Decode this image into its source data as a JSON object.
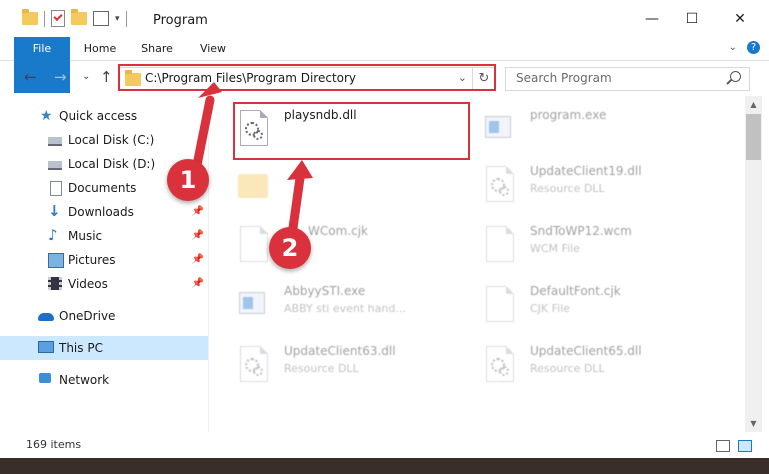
{
  "window": {
    "title": "Program",
    "controls": {
      "minimize": "—",
      "maximize": "☐",
      "close": "✕"
    }
  },
  "ribbon": {
    "tabs": [
      "File",
      "Home",
      "Share",
      "View"
    ],
    "help": "?"
  },
  "navbar": {
    "back": "←",
    "forward": "→",
    "recent": "⌄",
    "up": "↑",
    "address": "C:\\Program Files\\Program Directory",
    "refresh": "↻",
    "search_placeholder": "Search Program"
  },
  "sidebar": {
    "items": [
      {
        "label": "Quick access",
        "icon": "star-icon",
        "pinned": false
      },
      {
        "label": "Local Disk (C:)",
        "icon": "disk-icon",
        "pinned": false
      },
      {
        "label": "Local Disk (D:)",
        "icon": "disk-icon",
        "pinned": false
      },
      {
        "label": "Documents",
        "icon": "documents-icon",
        "pinned": false
      },
      {
        "label": "Downloads",
        "icon": "downloads-icon",
        "pinned": true
      },
      {
        "label": "Music",
        "icon": "music-icon",
        "pinned": true
      },
      {
        "label": "Pictures",
        "icon": "pictures-icon",
        "pinned": true
      },
      {
        "label": "Videos",
        "icon": "videos-icon",
        "pinned": true
      },
      {
        "label": "OneDrive",
        "icon": "onedrive-icon",
        "pinned": false
      },
      {
        "label": "This PC",
        "icon": "this-pc-icon",
        "pinned": false,
        "selected": true
      },
      {
        "label": "Network",
        "icon": "network-icon",
        "pinned": false
      }
    ]
  },
  "files": [
    {
      "name": "playsndb.dll",
      "desc": "",
      "type": "dll",
      "highlighted": true
    },
    {
      "name": "program.exe",
      "desc": "",
      "type": "exe"
    },
    {
      "name": "",
      "desc": "",
      "type": "folder"
    },
    {
      "name": "UpdateClient19.dll",
      "desc": "Resource DLL",
      "type": "dll"
    },
    {
      "name": "WCom.cjk",
      "desc": "",
      "type": "doc"
    },
    {
      "name": "SndToWP12.wcm",
      "desc": "WCM File",
      "type": "doc"
    },
    {
      "name": "AbbyySTI.exe",
      "desc": "ABBY sti event hand...",
      "type": "exe"
    },
    {
      "name": "DefaultFont.cjk",
      "desc": "CJK File",
      "type": "doc"
    },
    {
      "name": "UpdateClient63.dll",
      "desc": "Resource DLL",
      "type": "dll"
    },
    {
      "name": "UpdateClient65.dll",
      "desc": "Resource DLL",
      "type": "dll"
    }
  ],
  "status": {
    "item_count": "169 items"
  },
  "annotations": {
    "step1": "1",
    "step2": "2",
    "accent": "#d9323c"
  },
  "colors": {
    "file_tab": "#1979ca",
    "selection": "#cce8ff"
  }
}
